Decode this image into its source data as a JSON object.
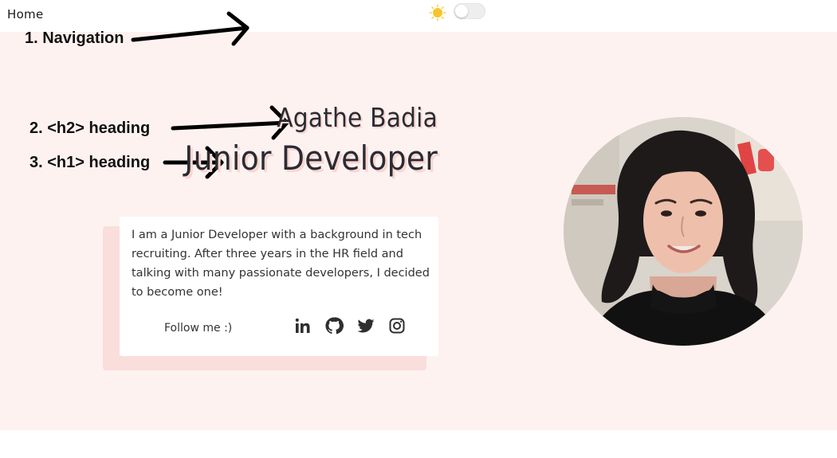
{
  "nav": {
    "home_label": "Home"
  },
  "theme_toggle": {
    "icon": "sun-icon",
    "state": "light",
    "sun_color": "#f7c52b"
  },
  "annotations": {
    "navigation": "1. Navigation",
    "h2": "2. <h2> heading",
    "h1": "3. <h1> heading"
  },
  "hero": {
    "name": "Agathe Badia",
    "title": "Junior Developer",
    "heading_shadow_color": "#f9d6d2",
    "background_color": "#fdf2f0"
  },
  "about_card": {
    "bio": "I am a Junior Developer with a background in tech recruiting. After three years in the HR field and talking with many passionate developers, I decided to become one!",
    "follow_label": "Follow me :)",
    "social_links": [
      {
        "name": "LinkedIn",
        "icon": "linkedin-icon"
      },
      {
        "name": "GitHub",
        "icon": "github-icon"
      },
      {
        "name": "Twitter",
        "icon": "twitter-icon"
      },
      {
        "name": "Instagram",
        "icon": "instagram-icon"
      }
    ]
  },
  "avatar": {
    "icon": "profile-photo"
  }
}
